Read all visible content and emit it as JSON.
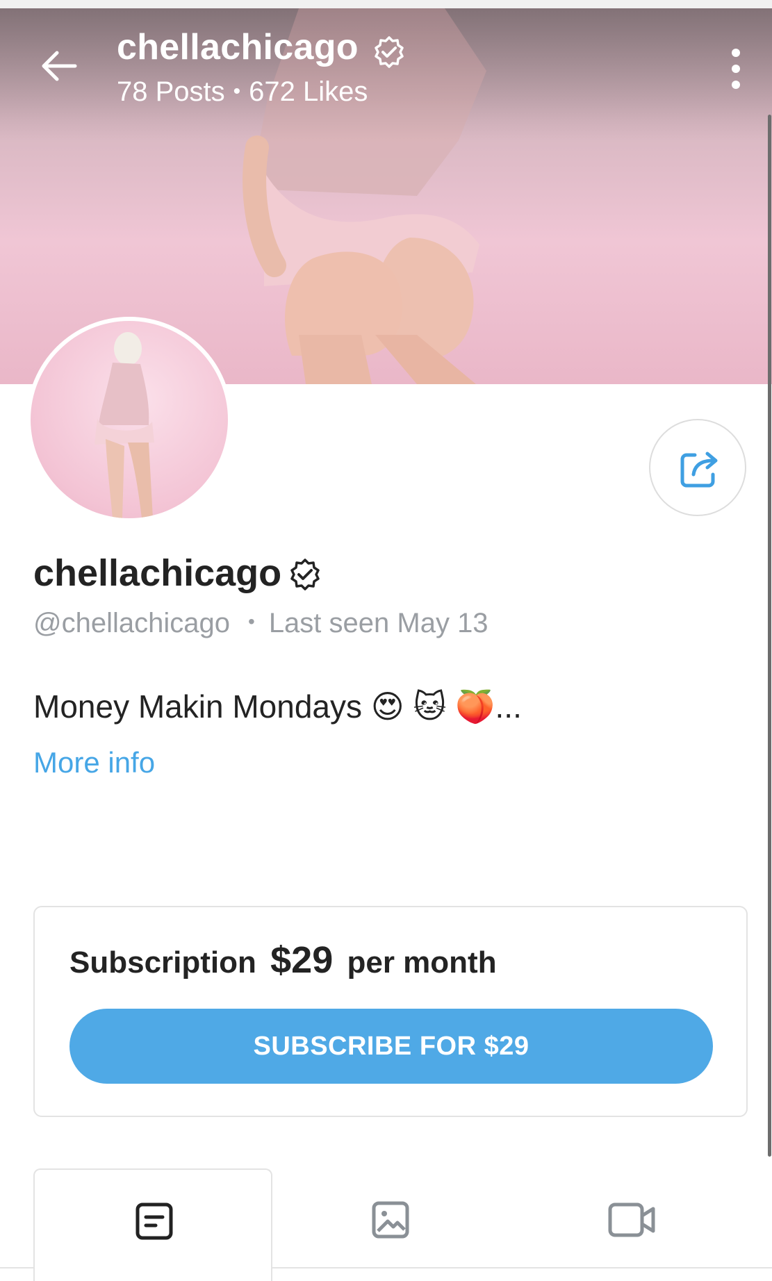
{
  "header": {
    "username": "chellachicago",
    "posts": "78 Posts",
    "likes": "672 Likes",
    "icons": {
      "back": "arrow-left-icon",
      "verified": "verified-badge-icon",
      "more": "more-vertical-icon"
    }
  },
  "profile": {
    "display_name": "chellachicago",
    "handle": "@chellachicago",
    "last_seen": "Last seen May 13",
    "bio": "Money Makin Mondays 😍 🐱 🍑...",
    "more_info": "More info",
    "icons": {
      "share": "share-icon",
      "verified": "verified-badge-icon"
    }
  },
  "subscription": {
    "label": "Subscription",
    "price": "$29",
    "period": "per month",
    "button": "SUBSCRIBE FOR $29"
  },
  "tabs": [
    {
      "icon": "posts-icon",
      "active": true
    },
    {
      "icon": "photos-icon",
      "active": false
    },
    {
      "icon": "videos-icon",
      "active": false
    }
  ],
  "colors": {
    "accent": "#4fa9e6",
    "link": "#46a6e6",
    "muted": "#9a9ea3",
    "text": "#232323"
  }
}
